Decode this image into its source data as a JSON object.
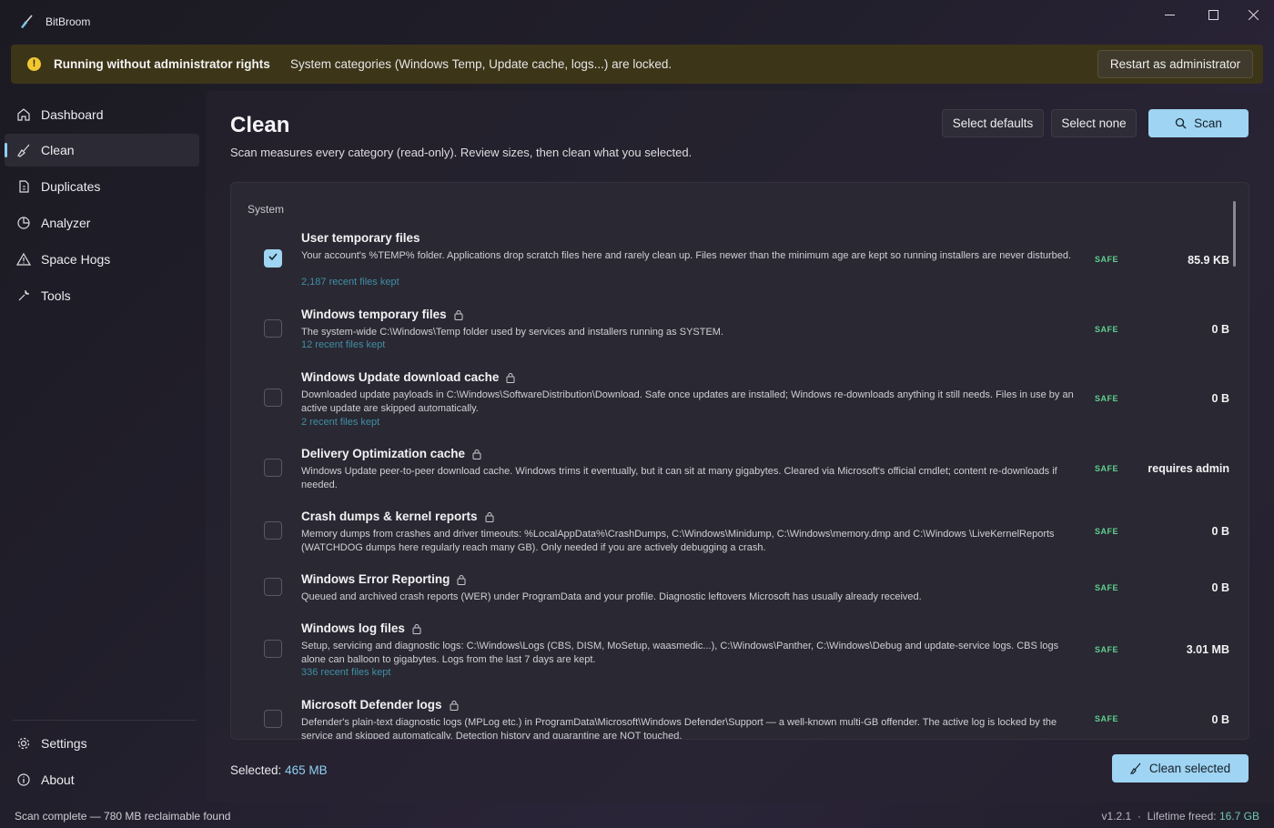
{
  "app": {
    "title": "BitBroom"
  },
  "banner": {
    "title": "Running without administrator rights",
    "message": "System categories (Windows Temp, Update cache, logs...) are locked.",
    "button": "Restart as administrator"
  },
  "sidebar": {
    "items": [
      {
        "label": "Dashboard",
        "icon": "home-icon",
        "active": false
      },
      {
        "label": "Clean",
        "icon": "broom-icon",
        "active": true
      },
      {
        "label": "Duplicates",
        "icon": "copy-icon",
        "active": false
      },
      {
        "label": "Analyzer",
        "icon": "pie-chart-icon",
        "active": false
      },
      {
        "label": "Space Hogs",
        "icon": "warning-icon",
        "active": false
      },
      {
        "label": "Tools",
        "icon": "wrench-icon",
        "active": false
      }
    ],
    "bottom": [
      {
        "label": "Settings",
        "icon": "gear-icon"
      },
      {
        "label": "About",
        "icon": "info-icon"
      }
    ]
  },
  "main": {
    "title": "Clean",
    "subtitle": "Scan measures every category (read-only). Review sizes, then clean what you selected.",
    "buttons": {
      "select_defaults": "Select defaults",
      "select_none": "Select none",
      "scan": "Scan"
    },
    "section": "System",
    "rows": [
      {
        "title": "User temporary files",
        "locked": false,
        "checked": true,
        "desc": "Your account's %TEMP% folder. Applications drop scratch files here and rarely clean up. Files newer than the minimum age are kept so running installers are never disturbed.",
        "note": "2,187 recent files kept",
        "badge": "SAFE",
        "size": "85.9 KB"
      },
      {
        "title": "Windows temporary files",
        "locked": true,
        "checked": false,
        "desc": "The system-wide C:\\Windows\\Temp folder used by services and installers running as SYSTEM.",
        "note": "12 recent files kept",
        "badge": "SAFE",
        "size": "0 B"
      },
      {
        "title": "Windows Update download cache",
        "locked": true,
        "checked": false,
        "desc": "Downloaded update payloads in C:\\Windows\\SoftwareDistribution\\Download. Safe once updates are installed; Windows re-downloads anything it still needs. Files in use by an active update are skipped automatically.",
        "note": "2 recent files kept",
        "badge": "SAFE",
        "size": "0 B"
      },
      {
        "title": "Delivery Optimization cache",
        "locked": true,
        "checked": false,
        "desc": "Windows Update peer-to-peer download cache. Windows trims it eventually, but it can sit at many gigabytes. Cleared via Microsoft's official cmdlet; content re-downloads if needed.",
        "note": "",
        "badge": "SAFE",
        "size": "requires admin"
      },
      {
        "title": "Crash dumps & kernel reports",
        "locked": true,
        "checked": false,
        "desc": "Memory dumps from crashes and driver timeouts: %LocalAppData%\\CrashDumps, C:\\Windows\\Minidump, C:\\Windows\\memory.dmp and C:\\Windows \\LiveKernelReports (WATCHDOG dumps here regularly reach many GB). Only needed if you are actively debugging a crash.",
        "note": "",
        "badge": "SAFE",
        "size": "0 B"
      },
      {
        "title": "Windows Error Reporting",
        "locked": true,
        "checked": false,
        "desc": "Queued and archived crash reports (WER) under ProgramData and your profile. Diagnostic leftovers Microsoft has usually already received.",
        "note": "",
        "badge": "SAFE",
        "size": "0 B"
      },
      {
        "title": "Windows log files",
        "locked": true,
        "checked": false,
        "desc": "Setup, servicing and diagnostic logs: C:\\Windows\\Logs (CBS, DISM, MoSetup, waasmedic...), C:\\Windows\\Panther, C:\\Windows\\Debug and update-service logs. CBS logs alone can balloon to gigabytes. Logs from the last 7 days are kept.",
        "note": "336 recent files kept",
        "badge": "SAFE",
        "size": "3.01 MB"
      },
      {
        "title": "Microsoft Defender logs",
        "locked": true,
        "checked": false,
        "desc": "Defender's plain-text diagnostic logs (MPLog etc.) in ProgramData\\Microsoft\\Windows Defender\\Support — a well-known multi-GB offender. The active log is locked by the service and skipped automatically. Detection history and quarantine are NOT touched.",
        "note": "",
        "badge": "SAFE",
        "size": "0 B"
      }
    ],
    "selected_label": "Selected:",
    "selected_value": "465 MB",
    "clean_button": "Clean selected"
  },
  "status": {
    "left": "Scan complete — 780 MB reclaimable found",
    "version": "v1.2.1",
    "freed_label": "Lifetime freed:",
    "freed_value": "16.7 GB"
  },
  "colors": {
    "accent": "#9fd4f2",
    "safe": "#5fcf90",
    "warning_bg": "#3d3518",
    "note": "#3f8fa6"
  }
}
